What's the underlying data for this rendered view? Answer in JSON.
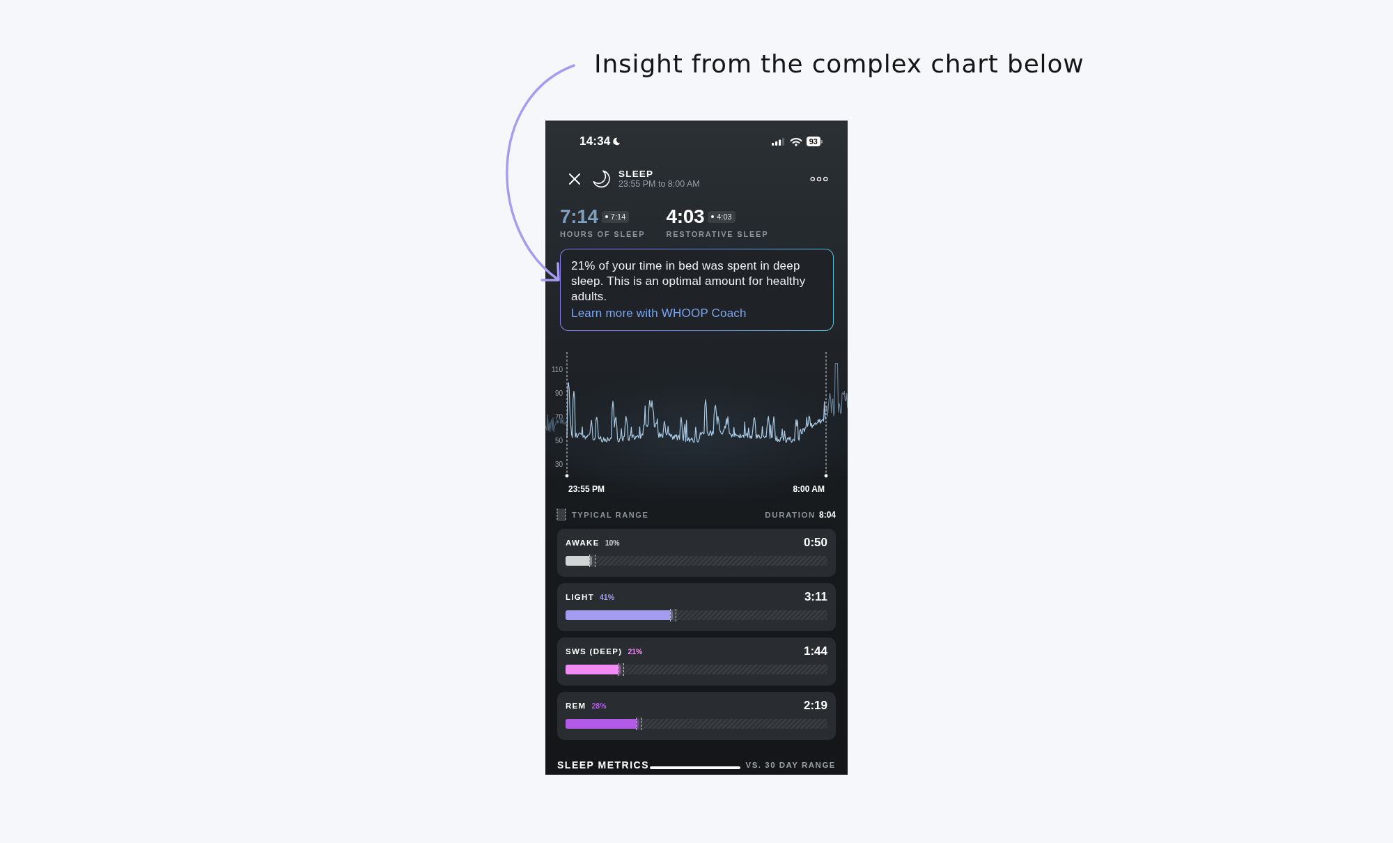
{
  "annotation": {
    "text": "Insight from the complex chart below"
  },
  "status_bar": {
    "time": "14:34",
    "battery": "93"
  },
  "header": {
    "title": "SLEEP",
    "subtitle": "23:55 PM to 8:00 AM"
  },
  "stats": [
    {
      "value": "7:14",
      "chip": "7:14",
      "label": "HOURS OF SLEEP",
      "color": "#7e9fbd"
    },
    {
      "value": "4:03",
      "chip": "4:03",
      "label": "RESTORATIVE SLEEP",
      "color": "#ffffff"
    }
  ],
  "insight": {
    "text": "21% of your time in bed was spent in deep sleep. This is an optimal amount for healthy adults.",
    "link": "Learn more with WHOOP Coach"
  },
  "chart": {
    "y_labels": [
      "110",
      "90",
      "70",
      "50",
      "30"
    ],
    "x_labels": [
      "23:55 PM",
      "8:00 AM"
    ]
  },
  "legend": {
    "label": "TYPICAL RANGE",
    "duration_label": "DURATION",
    "duration": "8:04"
  },
  "stages": [
    {
      "name": "AWAKE",
      "percent": "10%",
      "duration": "0:50",
      "level": 0.1,
      "color": "#d3d4d6"
    },
    {
      "name": "LIGHT",
      "percent": "41%",
      "duration": "3:11",
      "level": 0.41,
      "color": "#a39cf0"
    },
    {
      "name": "SWS (DEEP)",
      "percent": "21%",
      "duration": "1:44",
      "level": 0.21,
      "color": "#f28bf5"
    },
    {
      "name": "REM",
      "percent": "28%",
      "duration": "2:19",
      "level": 0.28,
      "color": "#b25be8"
    }
  ],
  "footer": {
    "title": "SLEEP METRICS",
    "note": "VS. 30 DAY RANGE"
  }
}
